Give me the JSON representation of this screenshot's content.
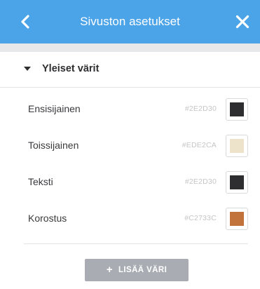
{
  "header": {
    "title": "Sivuston asetukset",
    "back_icon": "chevron-left-icon",
    "close_icon": "close-icon",
    "background": "#4BA3E8"
  },
  "section": {
    "title": "Yleiset värit",
    "icon": "caret-down-icon",
    "expanded": true
  },
  "colors": [
    {
      "name": "Ensisijainen",
      "hex": "#2E2D30",
      "value": "#2E2D30"
    },
    {
      "name": "Toissijainen",
      "hex": "#EDE2CA",
      "value": "#EDE2CA"
    },
    {
      "name": "Teksti",
      "hex": "#2E2D30",
      "value": "#2E2D30"
    },
    {
      "name": "Korostus",
      "hex": "#C2733C",
      "value": "#C2733C"
    }
  ],
  "add_button": {
    "icon": "plus-icon",
    "plus": "+",
    "label": "LISÄÄ VÄRI",
    "background": "#A9ADB3"
  }
}
